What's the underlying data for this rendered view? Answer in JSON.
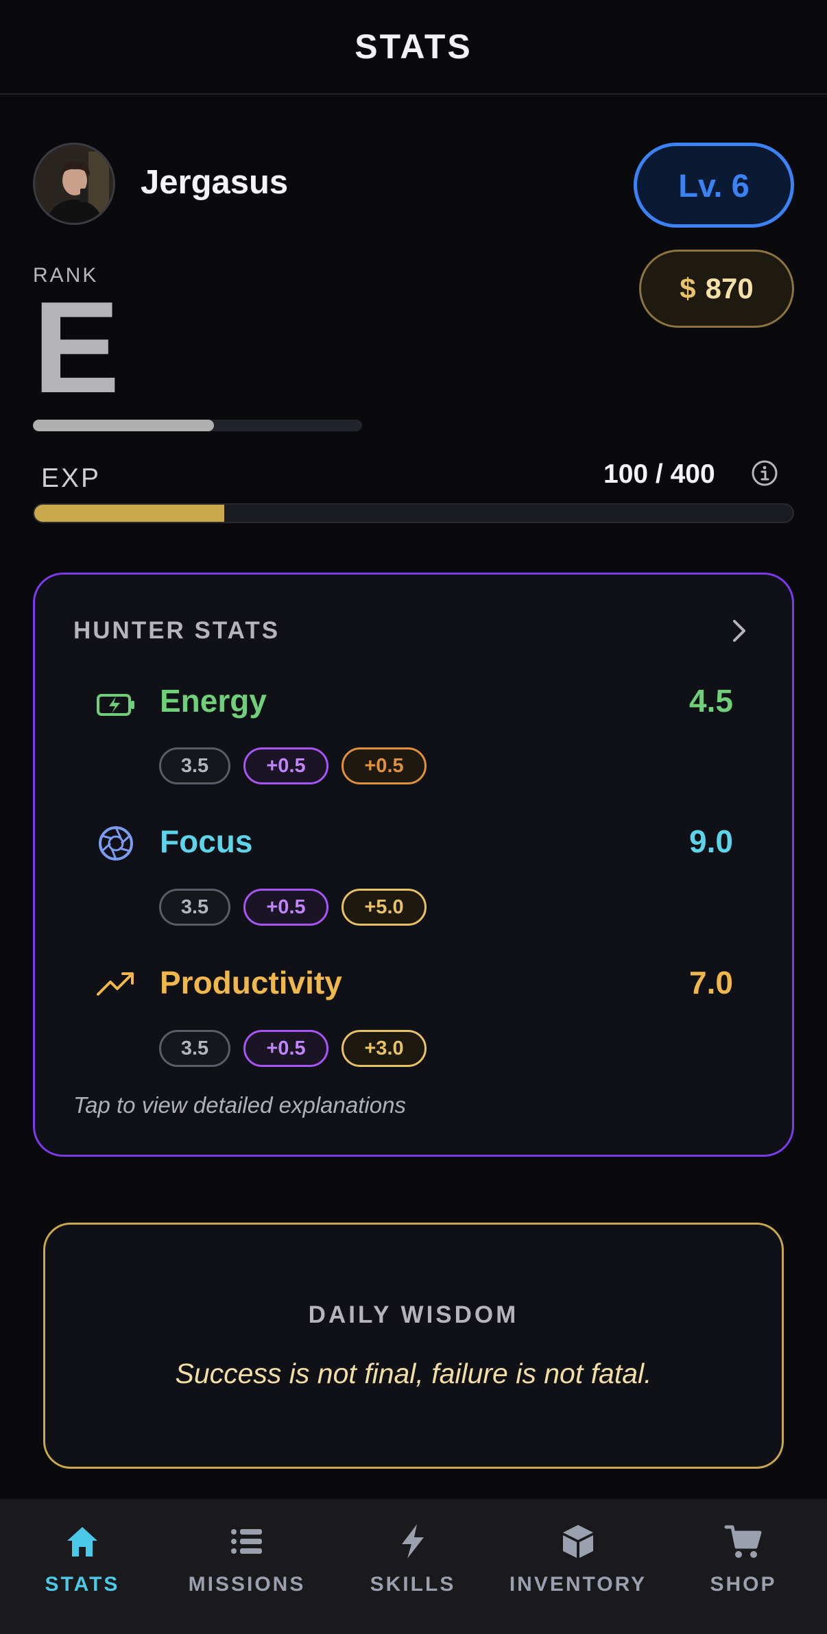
{
  "header": {
    "title": "STATS"
  },
  "profile": {
    "username": "Jergasus"
  },
  "level": {
    "label": "Lv. 6"
  },
  "currency": {
    "symbol": "$",
    "amount": "870"
  },
  "rank": {
    "label": "RANK",
    "letter": "E",
    "progress": 0.55
  },
  "exp": {
    "label": "EXP",
    "value": "100 / 400",
    "progress": 0.25
  },
  "hunter_stats": {
    "title": "HUNTER STATS",
    "hint": "Tap to view detailed explanations",
    "stats": [
      {
        "name": "Energy",
        "value": "4.5",
        "color": "#6fcf7a",
        "icon": "battery-charging-icon",
        "chips": [
          "3.5",
          "+0.5",
          "+0.5"
        ],
        "extra_color": "#e0913a"
      },
      {
        "name": "Focus",
        "value": "9.0",
        "color": "#5dd4ea",
        "icon": "aperture-icon",
        "chips": [
          "3.5",
          "+0.5",
          "+5.0"
        ],
        "extra_color": "#e8c266"
      },
      {
        "name": "Productivity",
        "value": "7.0",
        "color": "#f0b84c",
        "icon": "trending-up-icon",
        "chips": [
          "3.5",
          "+0.5",
          "+3.0"
        ],
        "extra_color": "#e8c266"
      }
    ]
  },
  "wisdom": {
    "title": "DAILY WISDOM",
    "quote": "Success is not final, failure is not fatal."
  },
  "nav": {
    "items": [
      {
        "label": "STATS",
        "icon": "home-icon",
        "active": true
      },
      {
        "label": "MISSIONS",
        "icon": "list-icon",
        "active": false
      },
      {
        "label": "SKILLS",
        "icon": "lightning-icon",
        "active": false
      },
      {
        "label": "INVENTORY",
        "icon": "cube-icon",
        "active": false
      },
      {
        "label": "SHOP",
        "icon": "cart-icon",
        "active": false
      }
    ]
  },
  "colors": {
    "accent_blue": "#3b82f6",
    "accent_purple": "#7c3aed",
    "accent_gold": "#c9a94c",
    "nav_active": "#4cc9e8"
  }
}
